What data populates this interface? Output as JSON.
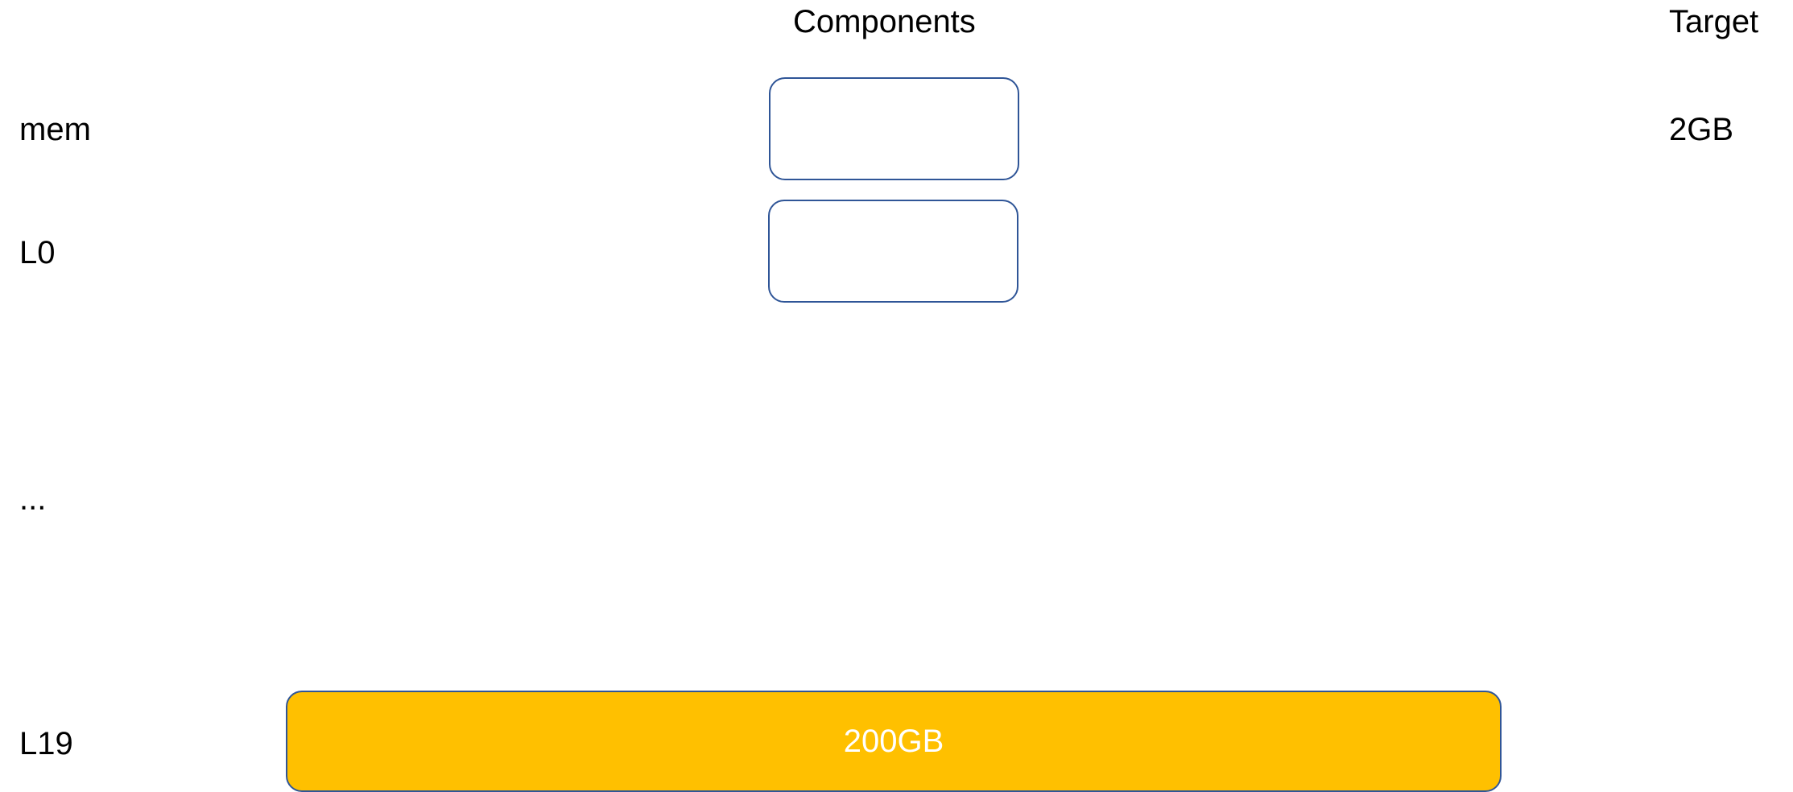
{
  "headers": {
    "components": "Components",
    "target": "Target"
  },
  "rows": {
    "mem": {
      "label": "mem",
      "target": "2GB"
    },
    "l0": {
      "label": "L0"
    },
    "ellipsis": {
      "label": "..."
    },
    "l19": {
      "label": "L19",
      "component_size": "200GB"
    }
  },
  "colors": {
    "box_border": "#2f5597",
    "bar_fill": "#ffc000",
    "bar_text": "#ffffff"
  }
}
